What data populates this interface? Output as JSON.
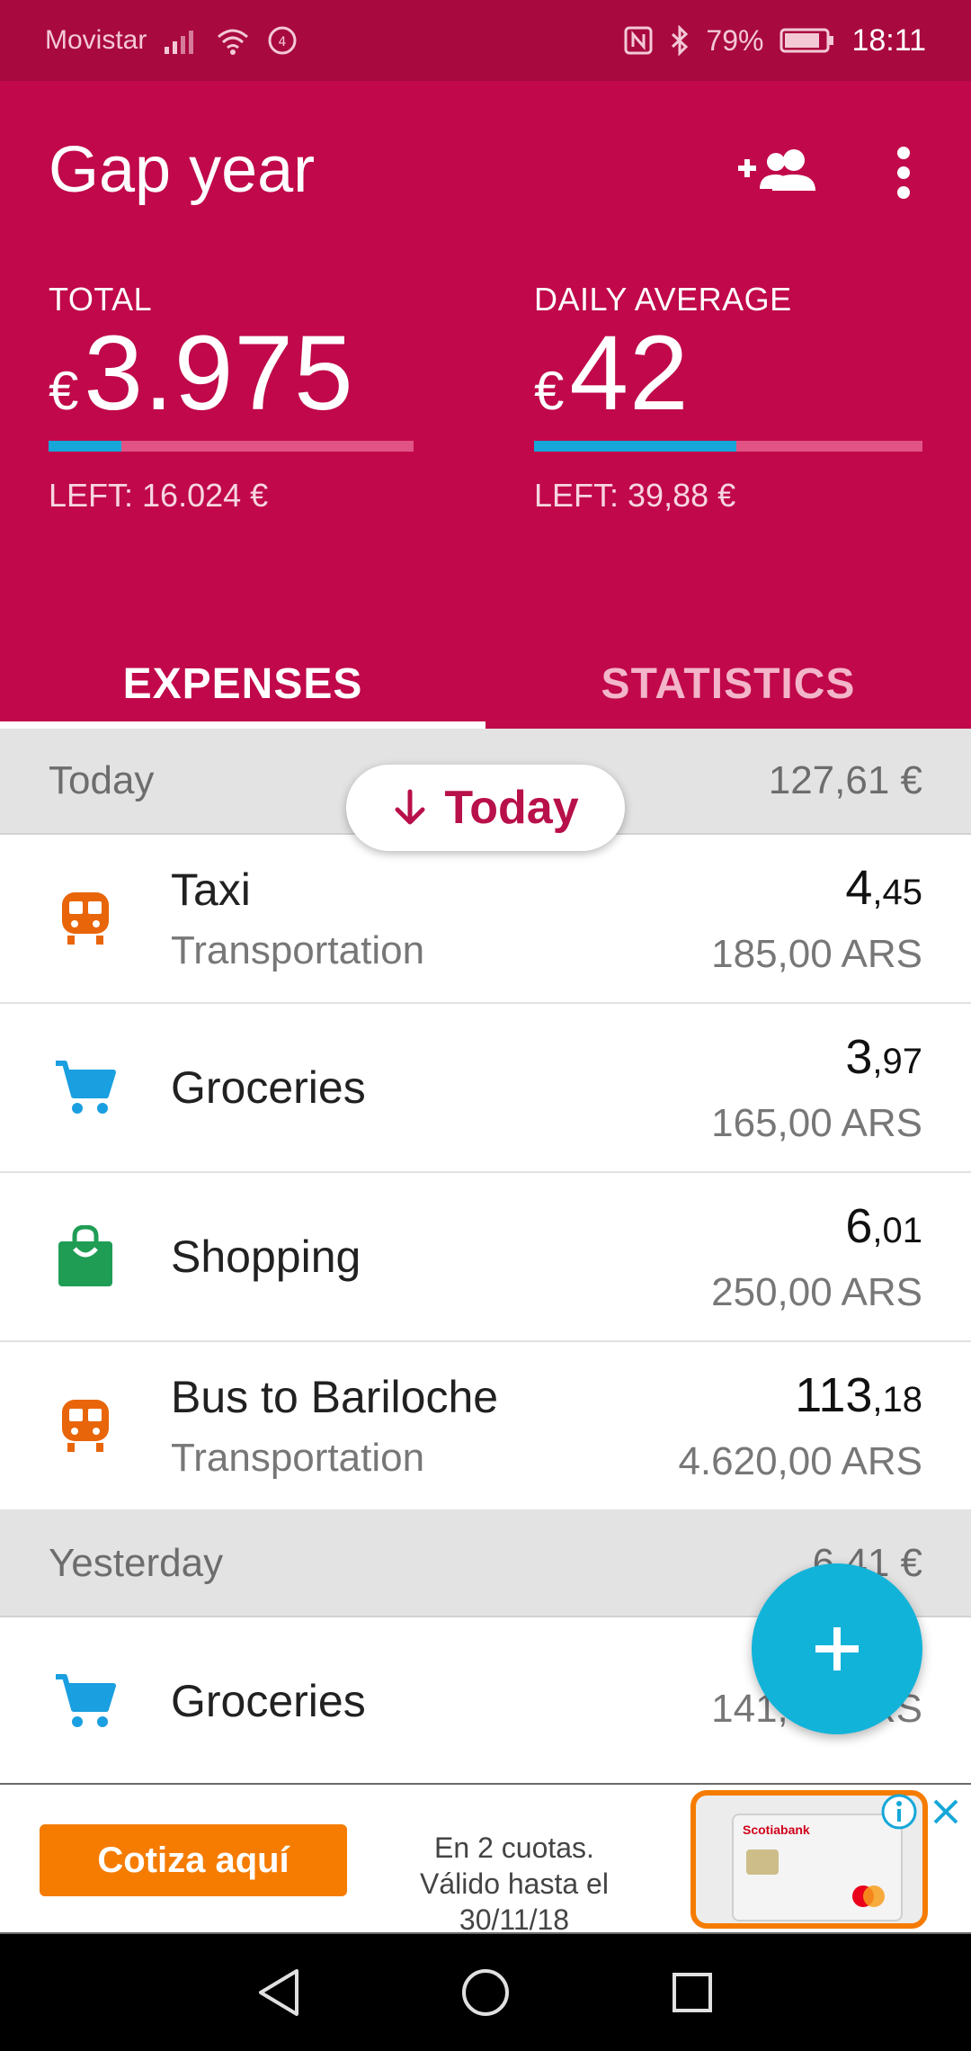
{
  "status_bar": {
    "carrier": "Movistar",
    "battery": "79%",
    "time": "18:11"
  },
  "header": {
    "title": "Gap year",
    "total": {
      "label": "TOTAL",
      "currency": "€",
      "amount": "3.975",
      "progress": 0.2,
      "left": "LEFT: 16.024 €"
    },
    "daily": {
      "label": "DAILY AVERAGE",
      "currency": "€",
      "amount": "42",
      "progress": 0.52,
      "left": "LEFT: 39,88 €"
    },
    "tabs": [
      {
        "label": "EXPENSES",
        "active": true
      },
      {
        "label": "STATISTICS",
        "active": false
      }
    ]
  },
  "today_pill": {
    "label": "Today"
  },
  "groups": [
    {
      "day": "Today",
      "total": "127,61 €",
      "expenses": [
        {
          "icon": "train-icon",
          "name": "Taxi",
          "category": "Transportation",
          "eur_int": "4",
          "eur_dec": ",45",
          "original": "185,00 ARS"
        },
        {
          "icon": "cart-icon",
          "name": "Groceries",
          "category": "",
          "eur_int": "3",
          "eur_dec": ",97",
          "original": "165,00 ARS"
        },
        {
          "icon": "shopping-bag-icon",
          "name": "Shopping",
          "category": "",
          "eur_int": "6",
          "eur_dec": ",01",
          "original": "250,00 ARS"
        },
        {
          "icon": "train-icon",
          "name": "Bus to Bariloche",
          "category": "Transportation",
          "eur_int": "113",
          "eur_dec": ",18",
          "original": "4.620,00 ARS"
        }
      ]
    },
    {
      "day": "Yesterday",
      "total": "6,41 €",
      "expenses": [
        {
          "icon": "cart-icon",
          "name": "Groceries",
          "category": "",
          "eur_int": "",
          "eur_dec": "",
          "original": "141,00 ARS"
        }
      ]
    }
  ],
  "ad": {
    "cta": "Cotiza aquí",
    "line1": "En 2 cuotas.",
    "line2": "Válido hasta el 30/11/18",
    "card_brand": "Scotiabank"
  },
  "colors": {
    "primary": "#c0084a",
    "status_bar": "#a8093f",
    "accent": "#12b3d9",
    "progress_fill": "#16a7d8",
    "transport": "#e8650a",
    "groceries": "#1a9fe0",
    "shopping": "#1f9d55"
  }
}
